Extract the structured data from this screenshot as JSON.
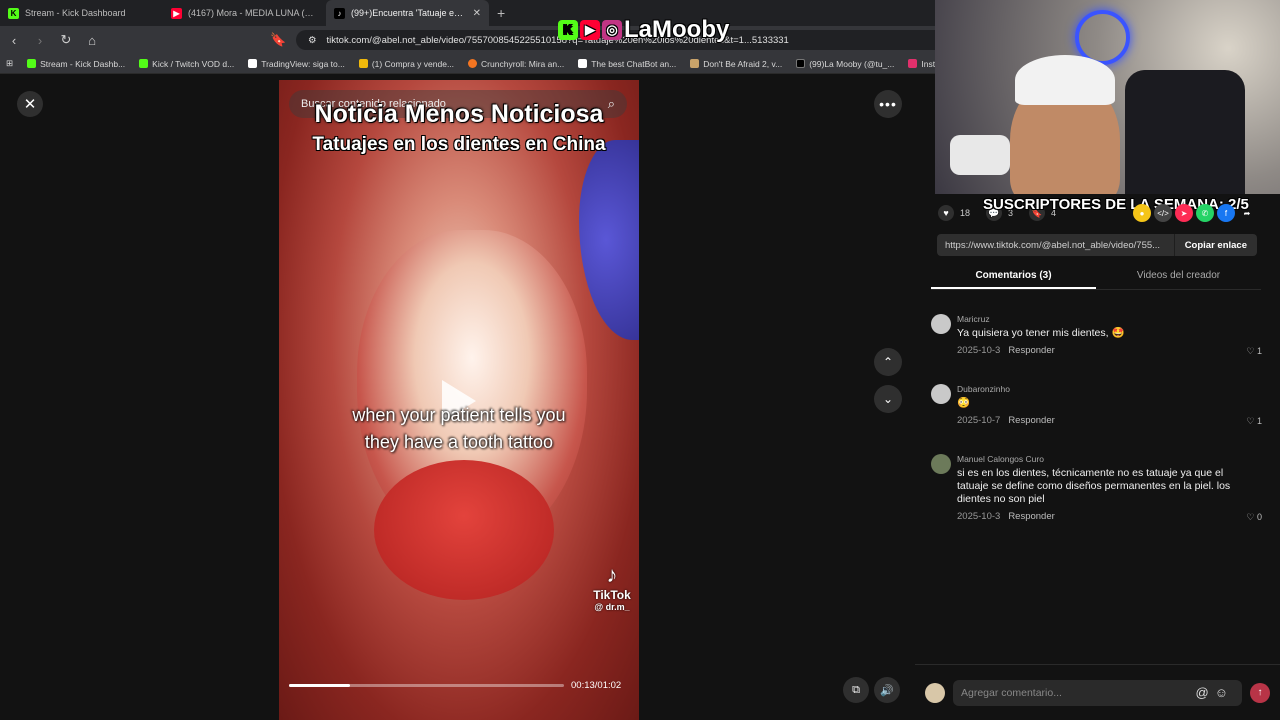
{
  "browser": {
    "tabs": [
      {
        "title": "Stream - Kick Dashboard",
        "color": "#53fc18",
        "icon": "K",
        "active": false
      },
      {
        "title": "(4167) Mora - MEDIA LUNA (Visualiz",
        "color": "#ff0033",
        "icon": "▶",
        "active": false
      },
      {
        "title": "(99+)Encuentra 'Tatuaje en lo",
        "color": "#000000",
        "icon": "♪",
        "active": true
      }
    ],
    "new_tab": "+",
    "url": "tiktok.com/@abel.not_able/video/7557008545225510158?q=Tatuaje%20en%20los%20dientes&t=1...5133331",
    "bookmarks": [
      {
        "label": "Stream - Kick Dashb...",
        "color": "#53fc18"
      },
      {
        "label": "Kick / Twitch VOD d...",
        "color": "#53fc18"
      },
      {
        "label": "TradingView: siga to...",
        "color": "#ffffff"
      },
      {
        "label": "(1) Compra y vende...",
        "color": "#f0b90b"
      },
      {
        "label": "Crunchyroll: Mira an...",
        "color": "#f47521"
      },
      {
        "label": "The best ChatBot an...",
        "color": "#ffffff"
      },
      {
        "label": "Don't Be Afraid 2, v...",
        "color": "#c9a36a"
      },
      {
        "label": "(99)La Mooby (@tu_...",
        "color": "#000000"
      },
      {
        "label": "Instagram",
        "color": "#e1306c"
      }
    ]
  },
  "overlay": {
    "brand": "LaMooby",
    "sub_banner": "SUSCRIPTORES DE LA SEMANA: 2/5"
  },
  "video": {
    "search_placeholder": "Buscar contenido relacionado",
    "title": "Noticia Menos Noticiosa",
    "subtitle": "Tatuajes en los dientes en China",
    "caption_line1": "when your patient tells you",
    "caption_line2": "they have a tooth tattoo",
    "watermark_brand": "TikTok",
    "watermark_handle": "@ dr.m_",
    "time": "00:13/01:02",
    "progress": 0.22
  },
  "side": {
    "likes": "18",
    "comments_count": "3",
    "saves": "4",
    "link": "https://www.tiktok.com/@abel.not_able/video/755...",
    "copy_label": "Copiar enlace",
    "tab_comments": "Comentarios (3)",
    "tab_creator": "Videos del creador",
    "comments": [
      {
        "user": "Maricruz",
        "text": "Ya quisiera yo tener mis dientes, 🤩",
        "date": "2025-10-3",
        "reply": "Responder",
        "likes": "1"
      },
      {
        "user": "Dubaronzinho",
        "text": "😳",
        "date": "2025-10-7",
        "reply": "Responder",
        "likes": "1"
      },
      {
        "user": "Manuel Calongos Curo",
        "text": "si es en los dientes, técnicamente no es tatuaje ya que el tatuaje se define como diseños permanentes en la piel. los dientes no son piel",
        "date": "2025-10-3",
        "reply": "Responder",
        "likes": "0"
      }
    ],
    "composer_placeholder": "Agregar comentario..."
  }
}
